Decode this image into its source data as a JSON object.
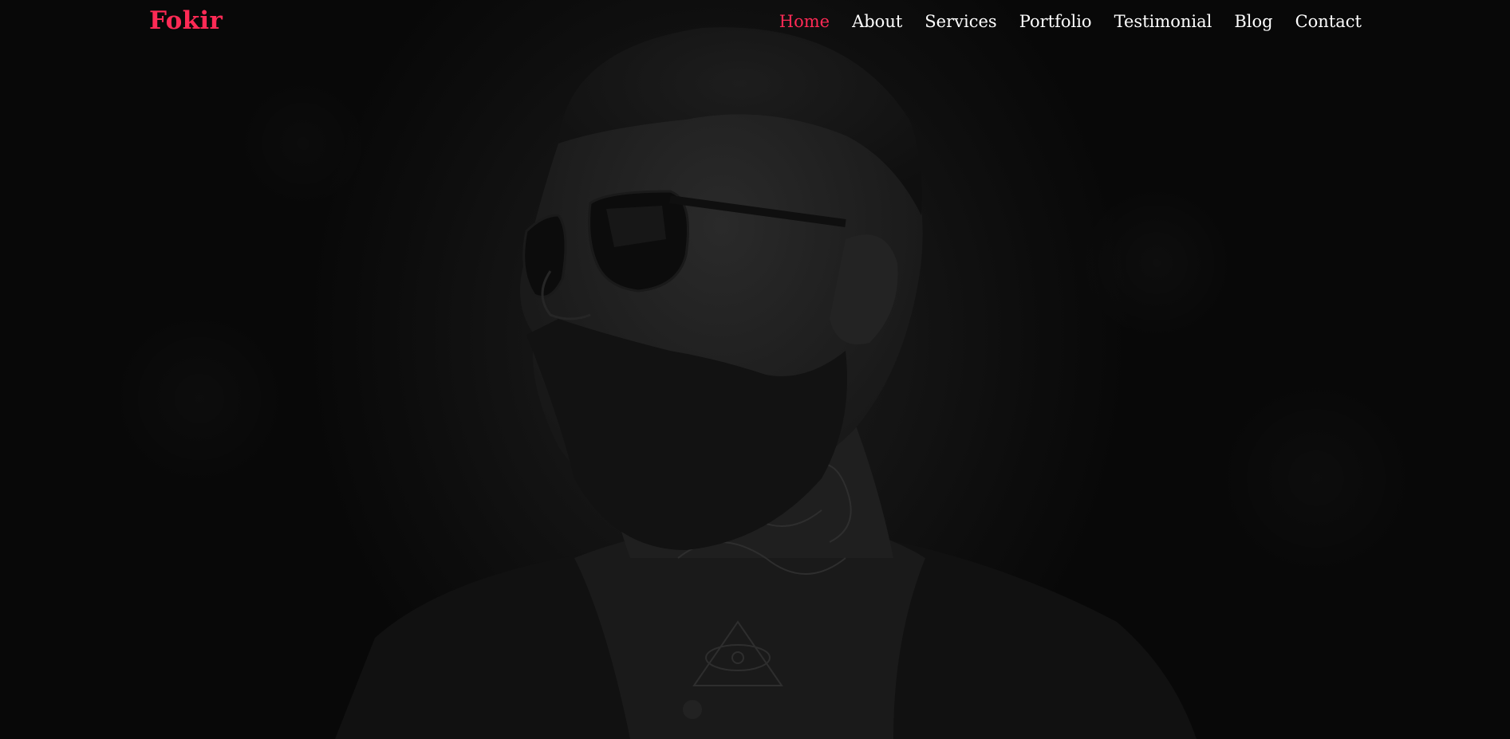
{
  "brand": {
    "name": "Fokir"
  },
  "nav": {
    "items": [
      {
        "label": "Home",
        "active": true
      },
      {
        "label": "About",
        "active": false
      },
      {
        "label": "Services",
        "active": false
      },
      {
        "label": "Portfolio",
        "active": false
      },
      {
        "label": "Testimonial",
        "active": false
      },
      {
        "label": "Blog",
        "active": false
      },
      {
        "label": "Contact",
        "active": false
      }
    ]
  },
  "colors": {
    "accent": "#ff2a55",
    "nav_text": "#ffffff",
    "background": "#0b0b0b"
  },
  "hero": {
    "image": "portrait of bearded man with sunglasses and neck tattoos"
  }
}
